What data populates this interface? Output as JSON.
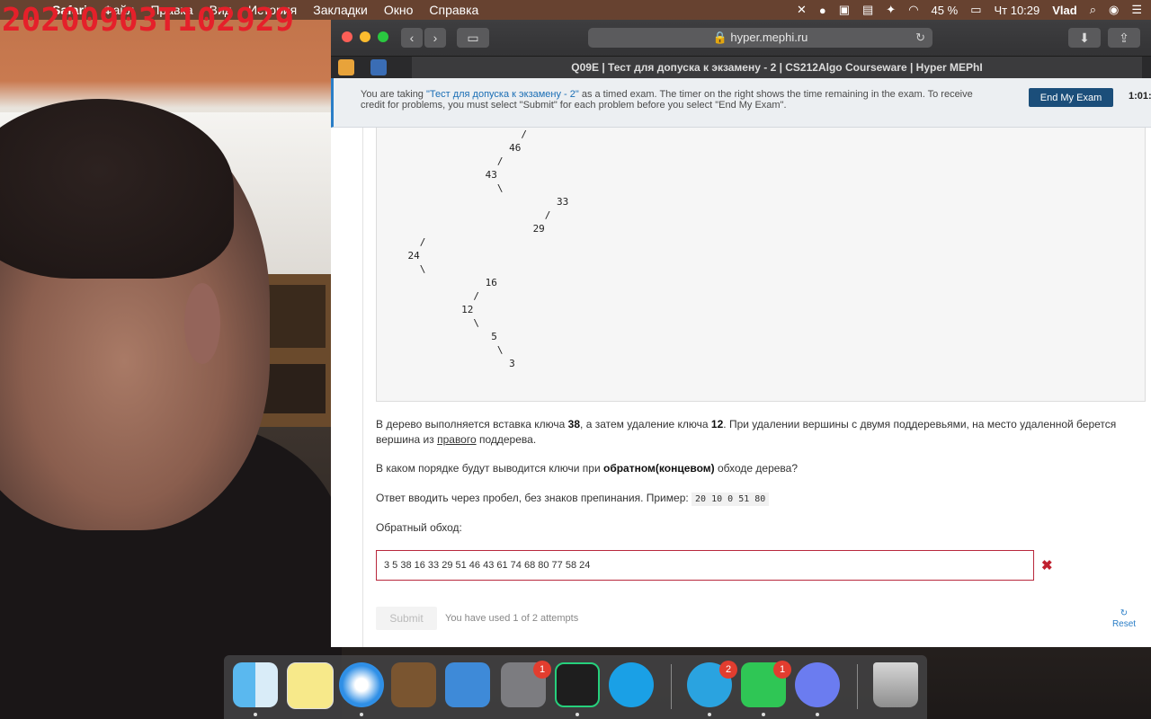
{
  "webcam_timestamp": "20200903T102929",
  "menubar": {
    "app": "Safari",
    "items": [
      "Файл",
      "Правка",
      "Вид",
      "История",
      "Закладки",
      "Окно",
      "Справка"
    ],
    "battery": "45 %",
    "clock": "Чт 10:29",
    "user": "Vlad"
  },
  "browser": {
    "url": "hyper.mephi.ru",
    "tab_title": "Q09E | Тест для допуска к экзамену - 2 | CS212Algo Courseware | Hyper MEPhI"
  },
  "banner": {
    "prefix": "You are taking ",
    "exam_link": "\"Тест для допуска к экзамену - 2\"",
    "suffix": " as a timed exam. The timer on the right shows the time remaining in the exam. To receive credit for problems, you must select \"Submit\" for each problem before you select \"End My Exam\".",
    "end_button": "End My Exam",
    "timer": "1:01:"
  },
  "tree_lines": [
    "                       /",
    "                     46",
    "                   /",
    "                 43",
    "                   \\",
    "                             33",
    "                           /",
    "                         29",
    "      /",
    "    24",
    "      \\",
    "                 16",
    "               /",
    "             12",
    "               \\",
    "                  5",
    "                   \\",
    "                     3"
  ],
  "question": {
    "p1_a": "В дерево выполняется вставка ключа ",
    "p1_k1": "38",
    "p1_b": ", а затем удаление ключа ",
    "p1_k2": "12",
    "p1_c": ". При удалении вершины с двумя поддеревьями, на место удаленной берется вершина из ",
    "p1_u": "правого",
    "p1_d": " поддерева.",
    "p2_a": "В каком порядке будут выводится ключи при ",
    "p2_b": "обратном(концевом)",
    "p2_c": " обходе дерева?",
    "p3": "Ответ вводить через пробел, без знаков препинания. Пример: ",
    "example": "20 10 0 51 80",
    "label": "Обратный обход:",
    "answer_value": "3 5 38 16 33 29 51 46 43 61 74 68 80 77 58 24"
  },
  "controls": {
    "submit": "Submit",
    "attempts": "You have used 1 of 2 attempts",
    "reset": "Reset"
  },
  "dock": {
    "items": [
      "finder",
      "notes",
      "safari",
      "guitar",
      "xcode",
      "system-preferences",
      "pycharm",
      "skype",
      "telegram",
      "facetime",
      "discord",
      "trash"
    ],
    "badges": {
      "system-preferences": "1",
      "telegram": "2",
      "facetime": "1"
    }
  }
}
